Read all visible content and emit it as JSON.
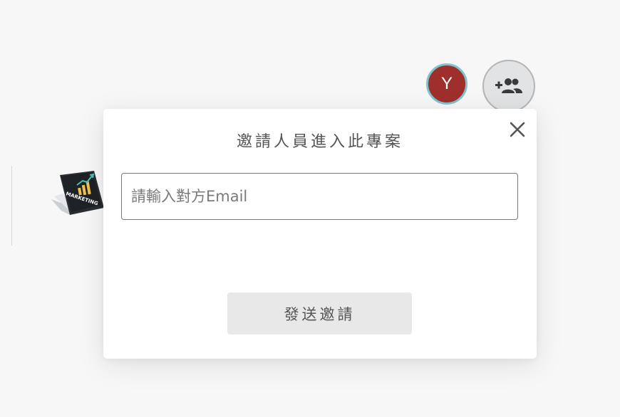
{
  "header": {
    "user_avatar_initial": "Y",
    "user_avatar_color": "#9e2f2c",
    "user_avatar_ring_color": "#7fc3cc",
    "add_member_icon": "add-people-icon"
  },
  "project": {
    "thumbnail_icon": "marketing-laptop-image",
    "thumbnail_text": "MARKETING"
  },
  "invite_modal": {
    "title": "邀請人員進入此專案",
    "email_placeholder": "請輸入對方Email",
    "email_value": "",
    "send_label": "發送邀請",
    "close_icon": "close-icon"
  }
}
